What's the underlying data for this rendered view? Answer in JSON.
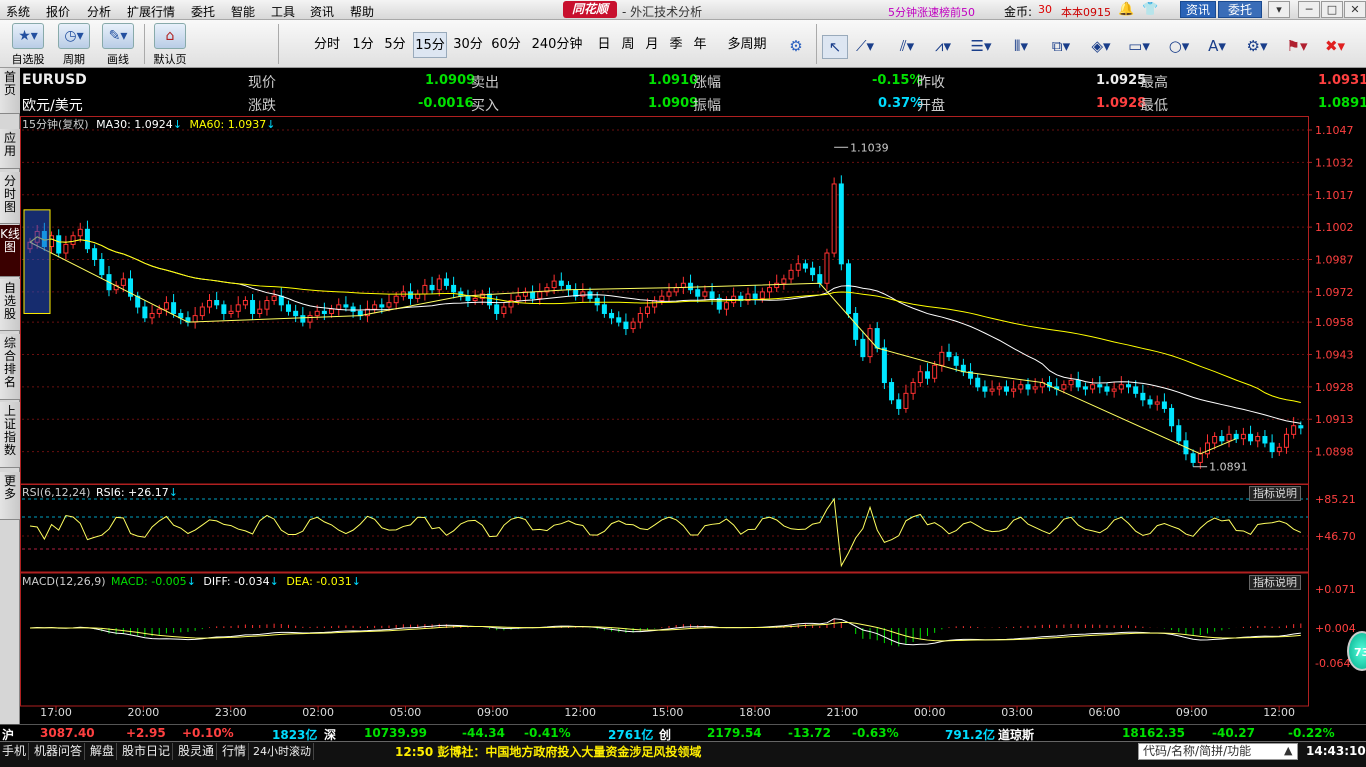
{
  "menubar": {
    "items": [
      "系统",
      "报价",
      "分析",
      "扩展行情",
      "委托",
      "智能",
      "工具",
      "资讯",
      "帮助"
    ],
    "logo": "同花顺",
    "title": "- 外汇技术分析",
    "ticker_title": "5分钟涨速榜前50",
    "coins_label": "金币:",
    "coins_value": "30",
    "version": "本本0915",
    "zixun": "资讯",
    "weituo": "委托"
  },
  "toolbar": {
    "big_buttons": [
      "自选股",
      "周期",
      "画线",
      "默认页"
    ],
    "periods": [
      "分时",
      "1分",
      "5分",
      "15分",
      "30分",
      "60分",
      "240分钟",
      "日",
      "周",
      "月",
      "季",
      "年",
      "多周期"
    ],
    "active_period": "15分"
  },
  "left_tabs": [
    "首页",
    "应用",
    "分时图",
    "K线图",
    "自选股",
    "综合排名",
    "上证指数",
    "更多"
  ],
  "quote": {
    "symbol": "EURUSD",
    "name": "欧元/美元",
    "labels": {
      "price": "现价",
      "change": "涨跌",
      "sell": "卖出",
      "buy": "买入",
      "pct": "涨幅",
      "amp": "振幅",
      "prev_close": "昨收",
      "open": "开盘",
      "high": "最高",
      "low": "最低"
    },
    "price": "1.0909",
    "change": "-0.0016",
    "sell": "1.0910",
    "buy": "1.0909",
    "pct": "-0.15%",
    "amp": "0.37%",
    "prev_close": "1.0925",
    "open": "1.0928",
    "high": "1.0931",
    "low": "1.0891"
  },
  "main_legend": {
    "period": "15分钟(复权)",
    "ma30_label": "MA30: 1.0924",
    "ma60_label": "MA60: 1.0937",
    "ma30_color": "#ffffff",
    "ma60_color": "#ffff00"
  },
  "rsi_legend": {
    "label": "RSI(6,12,24)",
    "value": "RSI6: +26.17"
  },
  "macd_legend": {
    "label": "MACD(12,26,9)",
    "macd": "MACD: -0.005",
    "diff": "DIFF: -0.034",
    "dea": "DEA: -0.031"
  },
  "indicator_btn": "指标说明",
  "chart_data": {
    "type": "candlestick",
    "price_axis": [
      "1.1047",
      "1.1032",
      "1.1017",
      "1.1002",
      "1.0987",
      "1.0972",
      "1.0958",
      "1.0943",
      "1.0928",
      "1.0913",
      "1.0898"
    ],
    "price_range": [
      1.0883,
      1.1047
    ],
    "rsi_axis": [
      "+85.21",
      "+46.70"
    ],
    "macd_axis": [
      "+0.071",
      "+0.004",
      "-0.064"
    ],
    "time_axis": [
      "17:00",
      "20:00",
      "23:00",
      "02:00",
      "05:00",
      "09:00",
      "12:00",
      "15:00",
      "18:00",
      "21:00",
      "00:00",
      "03:00",
      "06:00",
      "09:00",
      "12:00"
    ],
    "high_mark": "1.1039",
    "low_mark": "1.0891",
    "up_color": "#ff3232",
    "down_color": "#00e6ff",
    "closes": [
      1.0995,
      1.1,
      1.0993,
      1.0998,
      1.099,
      1.0994,
      1.0998,
      1.1001,
      1.0992,
      1.0987,
      1.098,
      1.0973,
      1.0975,
      1.0978,
      1.097,
      1.0965,
      1.096,
      1.0962,
      1.0964,
      1.0967,
      1.0962,
      1.096,
      1.0958,
      1.0961,
      1.0965,
      1.0968,
      1.0966,
      1.0962,
      1.0963,
      1.0966,
      1.0968,
      1.0962,
      1.0964,
      1.0968,
      1.097,
      1.0966,
      1.0963,
      1.0961,
      1.0958,
      1.0961,
      1.0963,
      1.0962,
      1.0964,
      1.0966,
      1.0965,
      1.0963,
      1.0961,
      1.0964,
      1.0966,
      1.0965,
      1.0967,
      1.097,
      1.0972,
      1.0969,
      1.0971,
      1.0975,
      1.0973,
      1.0978,
      1.0975,
      1.0972,
      1.097,
      1.0968,
      1.0969,
      1.0971,
      1.0966,
      1.0962,
      1.0965,
      1.0968,
      1.097,
      1.0972,
      1.0969,
      1.0972,
      1.0974,
      1.0977,
      1.0975,
      1.0973,
      1.097,
      1.0972,
      1.0969,
      1.0966,
      1.0962,
      1.096,
      1.0958,
      1.0955,
      1.0958,
      1.0962,
      1.0965,
      1.0968,
      1.097,
      1.0972,
      1.0974,
      1.0976,
      1.0973,
      1.097,
      1.0972,
      1.0969,
      1.0964,
      1.0967,
      1.097,
      1.0968,
      1.0971,
      1.0969,
      1.0972,
      1.0974,
      1.0976,
      1.0978,
      1.0982,
      1.0985,
      1.0983,
      1.098,
      1.0976,
      1.099,
      1.1022,
      1.0985,
      1.0962,
      1.095,
      1.0942,
      1.0955,
      1.0946,
      1.093,
      1.0922,
      1.0918,
      1.0925,
      1.093,
      1.0935,
      1.0932,
      1.0938,
      1.0944,
      1.0942,
      1.0938,
      1.0935,
      1.0932,
      1.0928,
      1.0926,
      1.0927,
      1.0928,
      1.0926,
      1.0927,
      1.0929,
      1.0927,
      1.0928,
      1.093,
      1.0928,
      1.0927,
      1.0929,
      1.0931,
      1.0928,
      1.0927,
      1.0929,
      1.0928,
      1.0926,
      1.0927,
      1.0929,
      1.0928,
      1.0925,
      1.0922,
      1.092,
      1.0921,
      1.0918,
      1.091,
      1.0903,
      1.0897,
      1.0893,
      1.0897,
      1.0902,
      1.0905,
      1.0903,
      1.0906,
      1.0904,
      1.0906,
      1.0903,
      1.0905,
      1.0902,
      1.0898,
      1.09,
      1.0906,
      1.091,
      1.0909
    ]
  },
  "indices": {
    "sh_label": "沪",
    "sh_val": "3087.40",
    "sh_chg": "+2.95",
    "sh_pct": "+0.10%",
    "sh_amt": "1823亿",
    "sz_label": "深",
    "sz_val": "10739.99",
    "sz_chg": "-44.34",
    "sz_pct": "-0.41%",
    "sz_amt": "2761亿",
    "cy_label": "创",
    "cy_val": "2179.54",
    "cy_chg": "-13.72",
    "cy_pct": "-0.63%",
    "cy_amt": "791.2亿",
    "dj_label": "道琼斯",
    "dj_val": "18162.35",
    "dj_chg": "-40.27",
    "dj_pct": "-0.22%"
  },
  "bottom_bar": {
    "tabs": [
      "手机",
      "机器问答",
      "解盘",
      "股市日记",
      "股灵通",
      "行情",
      "24小时滚动"
    ],
    "news_time": "12:50",
    "news": "彭博社：中国地方政府投入大量资金涉足风投领域",
    "search_placeholder": "代码/名称/简拼/功能",
    "clock": "14:43:10",
    "ball": "73"
  }
}
